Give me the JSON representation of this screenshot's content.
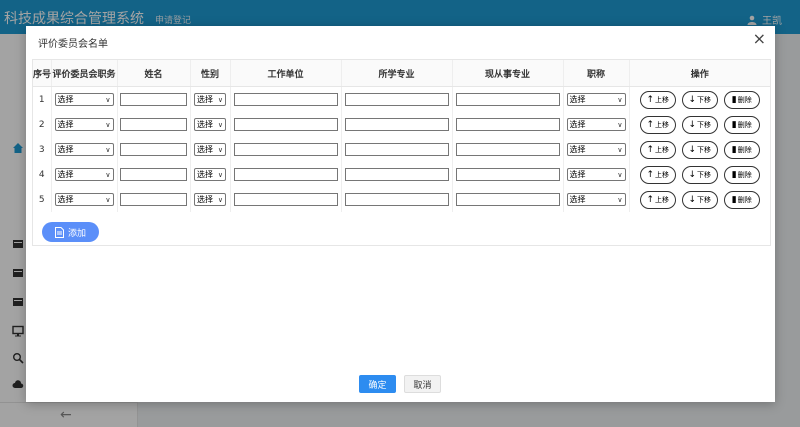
{
  "app": {
    "title": "科技成果综合管理系统",
    "nav_item": "申请登记",
    "user_name": "王凯"
  },
  "modal": {
    "title": "评价委员会名单",
    "close": "×",
    "columns": [
      "序号",
      "评价委员会职务",
      "姓名",
      "性别",
      "工作单位",
      "所学专业",
      "现从事专业",
      "职称",
      "操作"
    ],
    "rows": [
      {
        "index": "1",
        "duty": "选择",
        "gender": "选择",
        "title": "选择"
      },
      {
        "index": "2",
        "duty": "选择",
        "gender": "选择",
        "title": "选择"
      },
      {
        "index": "3",
        "duty": "选择",
        "gender": "选择",
        "title": "选择"
      },
      {
        "index": "4",
        "duty": "选择",
        "gender": "选择",
        "title": "选择"
      },
      {
        "index": "5",
        "duty": "选择",
        "gender": "选择",
        "title": "选择"
      }
    ],
    "row_actions": {
      "up": "上移",
      "down": "下移",
      "delete": "删除"
    },
    "add_label": "添加",
    "ok_label": "确定",
    "cancel_label": "取消"
  },
  "colors": {
    "topbar": "#1e9cd4",
    "primary": "#2d8cf0",
    "add_button": "#5b8ff9"
  }
}
